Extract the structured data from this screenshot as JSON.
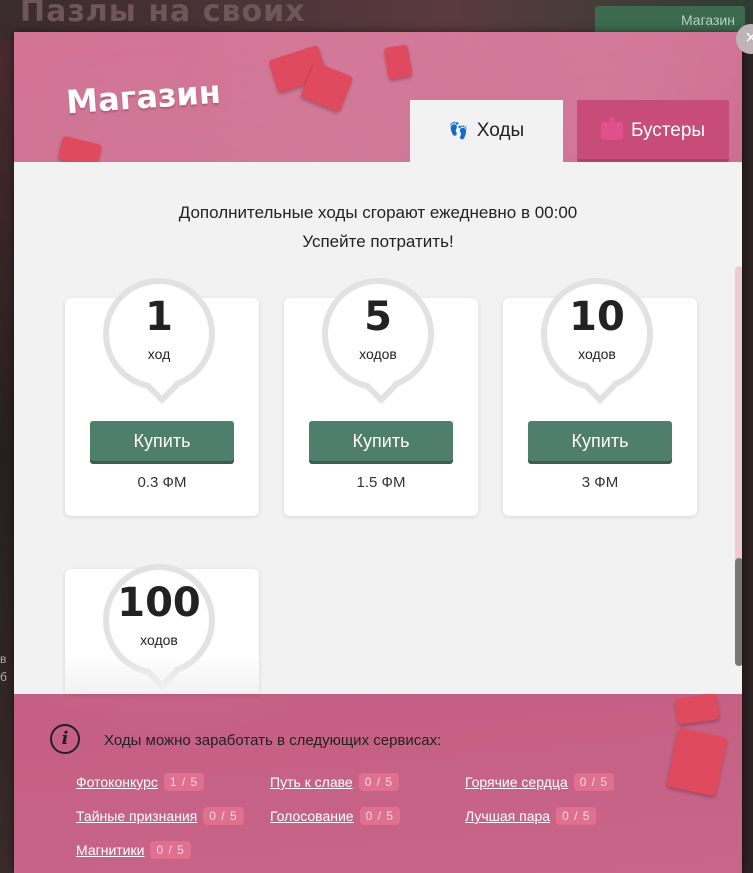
{
  "background": {
    "title": "Пазлы на своих",
    "shop_label": "Магазин",
    "left_texts": [
      "в",
      "б"
    ]
  },
  "modal": {
    "title": "Магазин",
    "close_label": "×",
    "tabs": [
      {
        "label": "Ходы",
        "icon": "footprints-icon",
        "active": true
      },
      {
        "label": "Бустеры",
        "icon": "puzzle-icon",
        "active": false
      }
    ],
    "notice_line1": "Дополнительные ходы сгорают ежедневно в 00:00",
    "notice_line2": "Успейте потратить!",
    "packs": [
      {
        "amount": "1",
        "unit": "ход",
        "button": "Купить",
        "price": "0.3 ФМ"
      },
      {
        "amount": "5",
        "unit": "ходов",
        "button": "Купить",
        "price": "1.5 ФМ"
      },
      {
        "amount": "10",
        "unit": "ходов",
        "button": "Купить",
        "price": "3 ФМ"
      },
      {
        "amount": "100",
        "unit": "ходов"
      }
    ],
    "footer": {
      "info_icon": "i",
      "title": "Ходы можно заработать в следующих сервисах:",
      "services": [
        {
          "name": "Фотоконкурс",
          "progress": "1 / 5"
        },
        {
          "name": "Путь к славе",
          "progress": "0 / 5"
        },
        {
          "name": "Горячие сердца",
          "progress": "0 / 5"
        },
        {
          "name": "Тайные признания",
          "progress": "0 / 5"
        },
        {
          "name": "Голосование",
          "progress": "0 / 5"
        },
        {
          "name": "Лучшая пара",
          "progress": "0 / 5"
        },
        {
          "name": "Магнитики",
          "progress": "0 / 5"
        }
      ]
    }
  },
  "colors": {
    "modal_pink": "#c45a7e",
    "buy_green": "#4f7e6a",
    "booster_tab": "#c74c77"
  }
}
